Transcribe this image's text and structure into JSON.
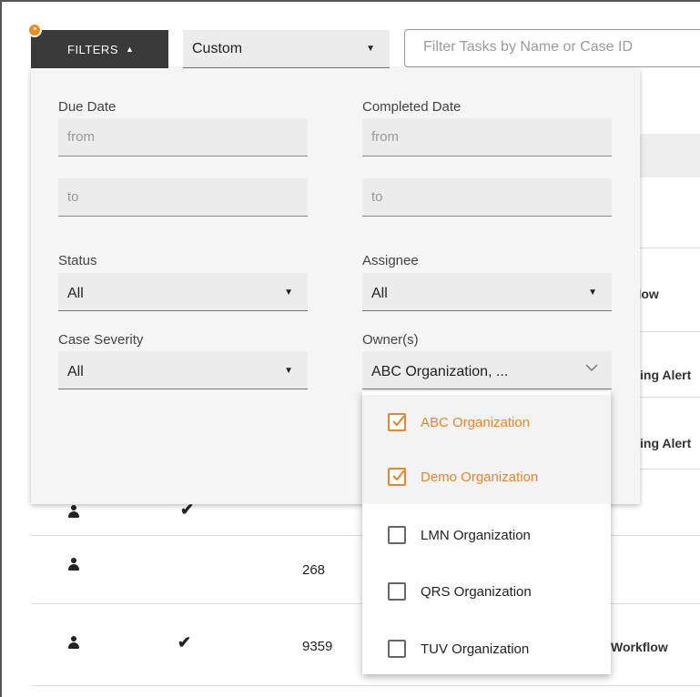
{
  "toolbar": {
    "filters_label": "FILTERS",
    "view_value": "Custom",
    "search_placeholder": "Filter Tasks by Name or Case ID"
  },
  "filters": {
    "due_date_label": "Due Date",
    "completed_date_label": "Completed Date",
    "from_placeholder": "from",
    "to_placeholder": "to",
    "status_label": "Status",
    "status_value": "All",
    "assignee_label": "Assignee",
    "assignee_value": "All",
    "severity_label": "Case Severity",
    "severity_value": "All",
    "owners_label": "Owner(s)",
    "owners_value": "ABC Organization, ..."
  },
  "owners_menu": [
    {
      "label": "ABC Organization",
      "checked": true
    },
    {
      "label": "Demo Organization",
      "checked": true
    },
    {
      "label": "LMN Organization",
      "checked": false
    },
    {
      "label": "QRS Organization",
      "checked": false
    },
    {
      "label": "TUV Organization",
      "checked": false
    }
  ],
  "table": {
    "partial_texts": [
      "kflow",
      "ing Alert",
      "ing Alert",
      "Workflow"
    ],
    "case_ids": [
      "268",
      "9359"
    ]
  },
  "colors": {
    "accent": "#e8852a",
    "button_dark": "#3a3a3a"
  }
}
